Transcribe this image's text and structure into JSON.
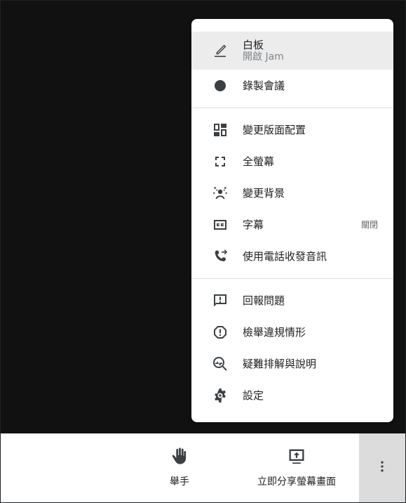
{
  "menu": {
    "whiteboard": {
      "label": "白板",
      "sublabel": "開啟 Jam"
    },
    "record": {
      "label": "錄製會議"
    },
    "change_layout": {
      "label": "變更版面配置"
    },
    "fullscreen": {
      "label": "全螢幕"
    },
    "change_background": {
      "label": "變更背景"
    },
    "captions": {
      "label": "字幕",
      "state": "關閉"
    },
    "phone_audio": {
      "label": "使用電話收發音訊"
    },
    "report_problem": {
      "label": "回報問題"
    },
    "report_abuse": {
      "label": "檢舉違規情形"
    },
    "troubleshooting": {
      "label": "疑難排解與說明"
    },
    "settings": {
      "label": "設定"
    }
  },
  "bottom_bar": {
    "raise_hand": {
      "label": "舉手",
      "icon": "raise-hand-icon"
    },
    "present_now": {
      "label": "立即分享螢幕畫面",
      "icon": "present-screen-icon"
    },
    "more_options": {
      "icon": "more-vert-icon"
    }
  }
}
